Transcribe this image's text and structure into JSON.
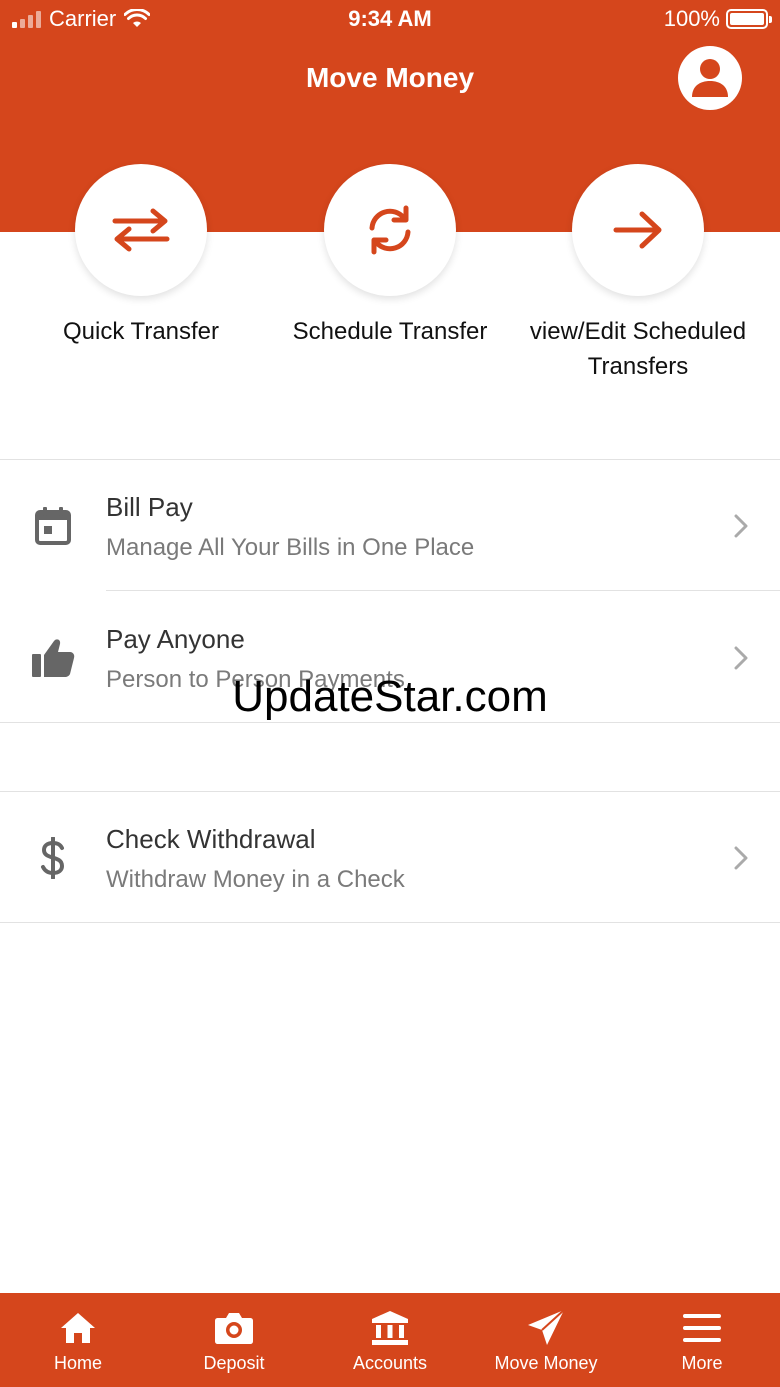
{
  "status_bar": {
    "carrier": "Carrier",
    "time": "9:34 AM",
    "battery": "100%"
  },
  "header": {
    "title": "Move Money",
    "profile_icon": "user-circle-icon"
  },
  "actions": [
    {
      "label": "Quick Transfer",
      "icon": "swap-arrows-icon"
    },
    {
      "label": "Schedule Transfer",
      "icon": "refresh-icon"
    },
    {
      "label": "view/Edit Scheduled Transfers",
      "icon": "arrow-right-icon"
    }
  ],
  "list": [
    {
      "title": "Bill Pay",
      "subtitle": "Manage All Your Bills in One Place",
      "icon": "calendar-icon"
    },
    {
      "title": "Pay Anyone",
      "subtitle": "Person to Person Payments",
      "icon": "thumbs-up-icon"
    },
    {
      "title": "Check Withdrawal",
      "subtitle": "Withdraw Money in a Check",
      "icon": "dollar-icon"
    }
  ],
  "watermark": "UpdateStar.com",
  "tabs": [
    {
      "label": "Home",
      "icon": "home-icon"
    },
    {
      "label": "Deposit",
      "icon": "camera-icon"
    },
    {
      "label": "Accounts",
      "icon": "bank-icon"
    },
    {
      "label": "Move Money",
      "icon": "send-icon"
    },
    {
      "label": "More",
      "icon": "menu-icon"
    }
  ],
  "active_tab": "Move Money",
  "colors": {
    "brand": "#d5461c",
    "text": "#333333",
    "subtext": "#7a7a7a"
  }
}
